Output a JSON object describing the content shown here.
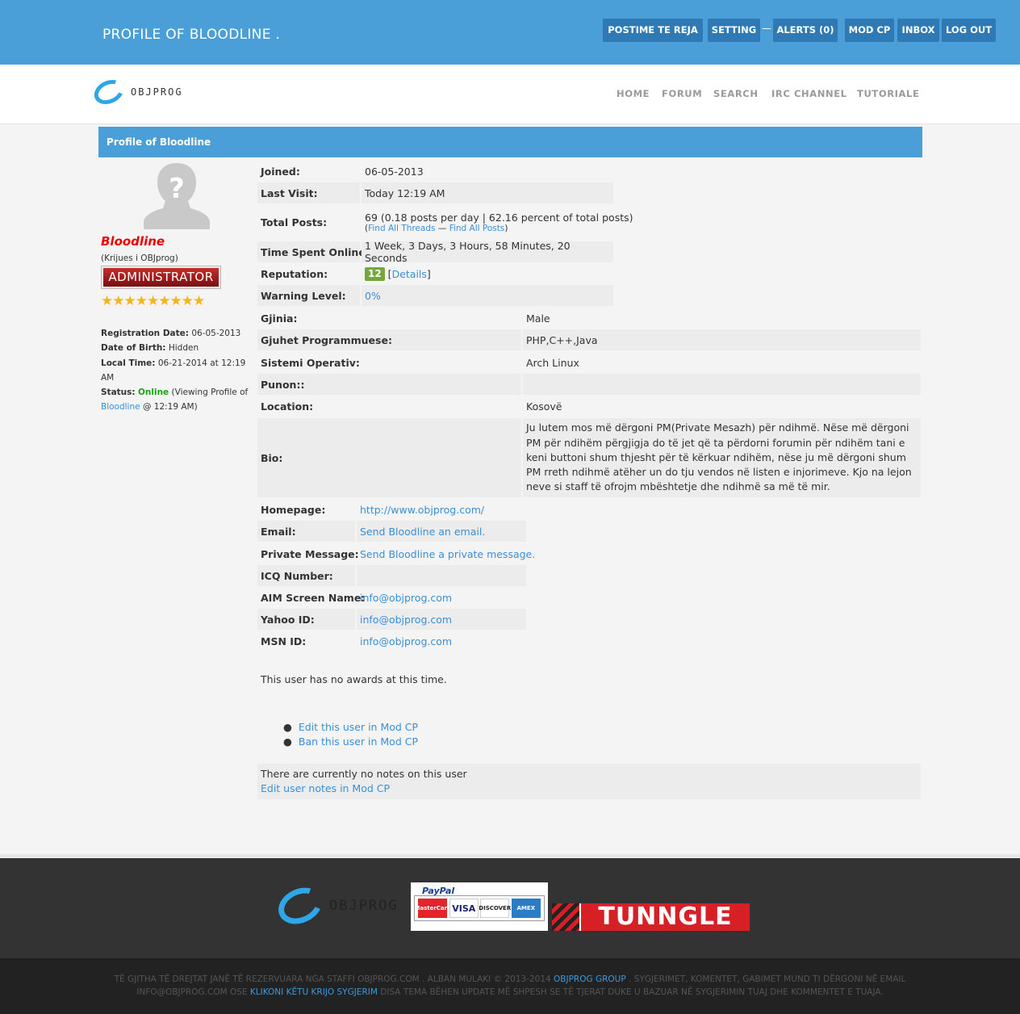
{
  "header": {
    "title": "PROFILE OF BLOODLINE .",
    "buttons": [
      "POSTIME TE REJA",
      "SETTING",
      "ALERTS (0)",
      "MOD CP",
      "INBOX",
      "LOG OUT"
    ],
    "separator": "—"
  },
  "logo": {
    "text": "OBJPROG"
  },
  "nav": [
    "HOME",
    "FORUM",
    "SEARCH",
    "IRC CHANNEL",
    "TUTORIALE"
  ],
  "profile": {
    "heading": "Profile of Bloodline",
    "username": "Bloodline",
    "usertitle": "(Krijues i OBJprog)",
    "group_badge": "ADMINISTRATOR",
    "stars": "★★★★★★★★★",
    "registration_label": "Registration Date:",
    "registration_value": "06-05-2013",
    "dob_label": "Date of Birth:",
    "dob_value": "Hidden",
    "localtime_label": "Local Time:",
    "localtime_value": "06-21-2014 at 12:19 AM",
    "status_label": "Status:",
    "status_value": "Online",
    "status_pre": "(Viewing Profile of",
    "status_link": "Bloodline",
    "status_post": "@ 12:19 AM)"
  },
  "stats": {
    "joined_label": "Joined:",
    "joined": "06-05-2013",
    "lastvisit_label": "Last Visit:",
    "lastvisit": "Today 12:19 AM",
    "posts_label": "Total Posts:",
    "posts": "69 (0.18 posts per day | 62.16 percent of total posts)",
    "find_threads": "Find All Threads",
    "find_posts": "Find All Posts",
    "find_sep": "—",
    "online_label": "Time Spent Online:",
    "online": "1 Week, 3 Days, 3 Hours, 58 Minutes, 20 Seconds",
    "rep_label": "Reputation:",
    "rep": "12",
    "rep_details": "Details",
    "warn_label": "Warning Level:",
    "warn": "0%"
  },
  "custom_fields": [
    {
      "label": "Gjinia:",
      "value": "Male"
    },
    {
      "label": "Gjuhet Programmuese:",
      "value": "PHP,C++,Java"
    },
    {
      "label": "Sistemi Operativ:",
      "value": "Arch Linux"
    },
    {
      "label": "Punon::",
      "value": ""
    },
    {
      "label": "Location:",
      "value": "Kosovë"
    },
    {
      "label": "Bio:",
      "value": "Ju lutem mos më dërgoni PM(Private Mesazh) për ndihmë. Nëse më dërgoni PM për ndihëm përgjigja do të jet që ta përdorni forumin për ndihëm tani e keni buttoni shum thjesht për të kërkuar ndihëm, nëse ju më dërgoni shum PM rreth ndihmë atëher un do tju vendos në listen e injorimeve. Kjo na lejon neve si staff të ofrojm mbështetje dhe ndihmë sa më të mir."
    }
  ],
  "contact": [
    {
      "label": "Homepage:",
      "value": "http://www.objprog.com/"
    },
    {
      "label": "Email:",
      "value": "Send Bloodline an email."
    },
    {
      "label": "Private Message:",
      "value": "Send Bloodline a private message."
    },
    {
      "label": "ICQ Number:",
      "value": ""
    },
    {
      "label": "AIM Screen Name:",
      "value": "info@objprog.com"
    },
    {
      "label": "Yahoo ID:",
      "value": "info@objprog.com"
    },
    {
      "label": "MSN ID:",
      "value": "info@objprog.com"
    }
  ],
  "awards": "This user has no awards at this time.",
  "modcp": [
    "Edit this user in Mod CP",
    "Ban this user in Mod CP"
  ],
  "notes": {
    "text": "There are currently no notes on this user",
    "link": "Edit user notes in Mod CP"
  },
  "footer": {
    "paypal": "PayPal",
    "cards": [
      "MasterCard",
      "VISA",
      "DISCOVER",
      "AMEX"
    ],
    "tunngle": "TUNNGLE",
    "copy_1": "TË GJITHA TË DREJTAT JANË TË REZERVUARA NGA STAFFI OBJPROG.COM . ALBAN MULAKI © 2013-2014",
    "copy_link1": "OBJPROG GROUP",
    "copy_2": ". SYGJERIMET, KOMENTET, GABIMET MUND TI DËRGONI NË EMAIL INFO@OBJPROG.COM OSE",
    "copy_link2": "KLIKONI KËTU KRIJO SYGJERIM",
    "copy_3": "DISA TEMA BËHEN UPDATE MË SHPESH SE TË TJERAT DUKE U BAZUAR NË SYGJERIMIN TUAJ DHE KOMMENTET E TUAJA."
  }
}
